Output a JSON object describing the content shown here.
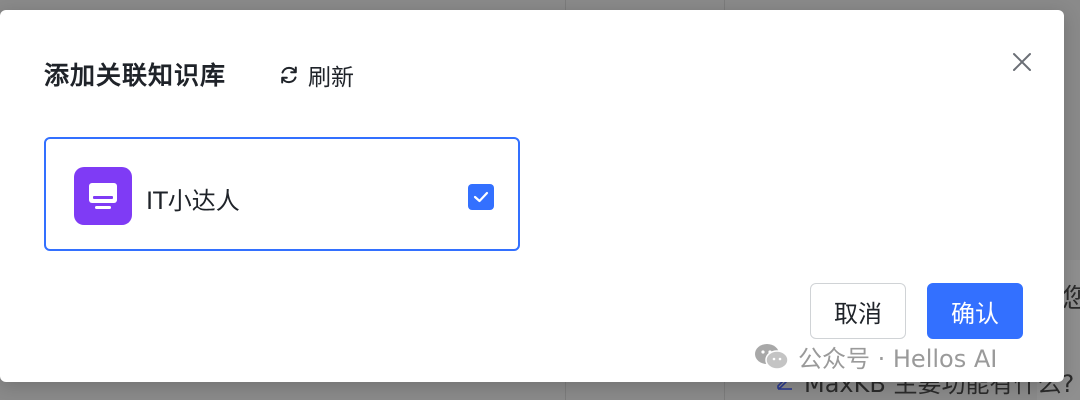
{
  "background": {
    "text_line_1": "您",
    "text_line_2": "MaxKB 主要功能有什么?"
  },
  "dialog": {
    "title": "添加关联知识库",
    "refresh_label": "刷新",
    "close_icon": "close-icon"
  },
  "knowledge_bases": [
    {
      "name": "IT小达人",
      "icon": "monitor-icon",
      "icon_bg_color": "#7f3bf5",
      "selected": true
    }
  ],
  "footer": {
    "cancel_label": "取消",
    "confirm_label": "确认"
  },
  "watermark": {
    "text": "公众号 · Hellos AI"
  },
  "colors": {
    "primary": "#3370ff",
    "text": "#1f2329",
    "border": "#d0d3d6"
  }
}
